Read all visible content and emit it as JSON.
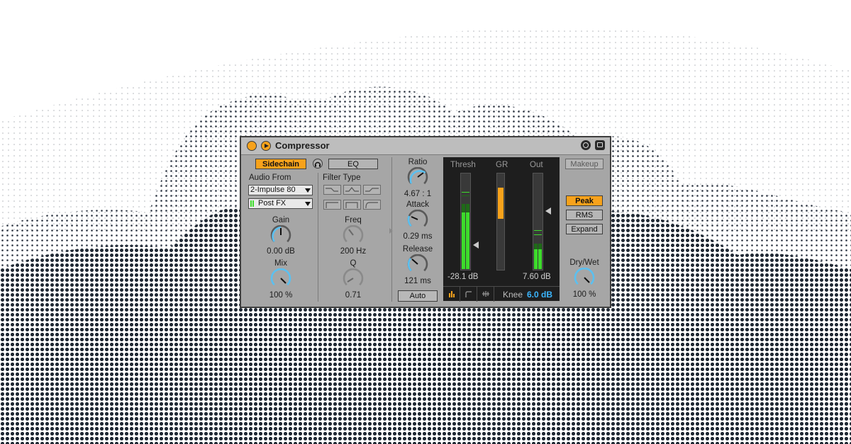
{
  "device": {
    "title": "Compressor",
    "sidechain_label": "Sidechain",
    "eq_label": "EQ",
    "audio_from_label": "Audio From",
    "audio_from_value": "2-Impulse 80",
    "audio_from_tap": "Post FX",
    "filter_type_label": "Filter Type",
    "gain": {
      "label": "Gain",
      "value": "0.00 dB"
    },
    "mix": {
      "label": "Mix",
      "value": "100 %"
    },
    "freq": {
      "label": "Freq",
      "value": "200 Hz"
    },
    "q": {
      "label": "Q",
      "value": "0.71"
    },
    "ratio": {
      "label": "Ratio",
      "value": "4.67 : 1"
    },
    "attack": {
      "label": "Attack",
      "value": "0.29 ms"
    },
    "release": {
      "label": "Release",
      "value": "121 ms"
    },
    "auto_label": "Auto",
    "meter": {
      "thresh_label": "Thresh",
      "gr_label": "GR",
      "out_label": "Out",
      "thresh_value": "-28.1 dB",
      "out_value": "7.60 dB",
      "knee_label": "Knee",
      "knee_value": "6.0 dB"
    },
    "makeup_label": "Makeup",
    "mode_buttons": [
      "Peak",
      "RMS",
      "Expand"
    ],
    "active_mode": "Peak",
    "drywet": {
      "label": "Dry/Wet",
      "value": "100 %"
    }
  },
  "colors": {
    "accent_orange": "#f7a21b",
    "meter_green": "#3ddc2b",
    "knob_blue": "#5bc0f0",
    "knee_blue": "#3bb6ff"
  }
}
